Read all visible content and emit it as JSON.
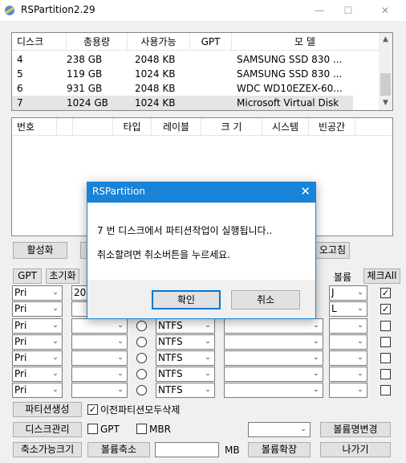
{
  "window": {
    "title": "RSPartition2.29",
    "controls": {
      "minimize": "—",
      "maximize": "☐",
      "close": "✕"
    }
  },
  "disk_list": {
    "columns": [
      "디스크",
      "총용량",
      "사용가능",
      "GPT",
      "모      델"
    ],
    "rows": [
      {
        "disk": "4",
        "capacity": "238 GB",
        "available": "2048 KB",
        "gpt": "",
        "model": "SAMSUNG SSD 830 ..."
      },
      {
        "disk": "5",
        "capacity": "119 GB",
        "available": "1024 KB",
        "gpt": "",
        "model": "SAMSUNG SSD 830 ..."
      },
      {
        "disk": "6",
        "capacity": "931 GB",
        "available": "2048 KB",
        "gpt": "",
        "model": "WDC WD10EZEX-60..."
      },
      {
        "disk": "7",
        "capacity": "1024 GB",
        "available": "1024 KB",
        "gpt": "",
        "model": "Microsoft Virtual Disk"
      }
    ],
    "selected_index": 3
  },
  "partition_list": {
    "columns": [
      "번호",
      "",
      "",
      "타입",
      "레이블",
      "크 기",
      "시스템",
      "빈공간"
    ]
  },
  "buttons": {
    "activate": "활성화",
    "repair": "오고침",
    "gpt": "GPT",
    "init": "초기화",
    "check_all": "체크All",
    "create_partition": "파티션생성",
    "disk_manage": "디스크관리",
    "shrinkable": "축소가능크기",
    "shrink_volume": "볼륨축소",
    "extend_volume": "볼륨확장",
    "rename_volume": "볼륨명변경",
    "exit": "나가기"
  },
  "labels": {
    "volume": "볼륨",
    "delete_all_prev": "이전파티션모두삭제",
    "gpt_opt": "GPT",
    "mbr_opt": "MBR",
    "mb": "MB"
  },
  "partition_rows": [
    {
      "type": "Pri",
      "size": "200",
      "fs": "",
      "letter": "J",
      "checked": true
    },
    {
      "type": "Pri",
      "size": "",
      "fs": "",
      "letter": "L",
      "checked": true
    },
    {
      "type": "Pri",
      "size": "",
      "fs": "NTFS",
      "letter": "",
      "checked": false
    },
    {
      "type": "Pri",
      "size": "",
      "fs": "NTFS",
      "letter": "",
      "checked": false
    },
    {
      "type": "Pri",
      "size": "",
      "fs": "NTFS",
      "letter": "",
      "checked": false
    },
    {
      "type": "Pri",
      "size": "",
      "fs": "NTFS",
      "letter": "",
      "checked": false
    },
    {
      "type": "Pri",
      "size": "",
      "fs": "NTFS",
      "letter": "",
      "checked": false
    }
  ],
  "options": {
    "delete_all_prev_checked": true,
    "gpt_checked": false,
    "mbr_checked": false
  },
  "dialog": {
    "title": "RSPartition",
    "line1": "7 번 디스크에서 파티션작업이 실행됩니다..",
    "line2": "취소할려면 취소버튼을 누르세요.",
    "ok": "확인",
    "cancel": "취소"
  },
  "colors": {
    "accent": "#1883d7",
    "button_face": "#e1e1e1",
    "window_bg": "#f0f0f0"
  }
}
